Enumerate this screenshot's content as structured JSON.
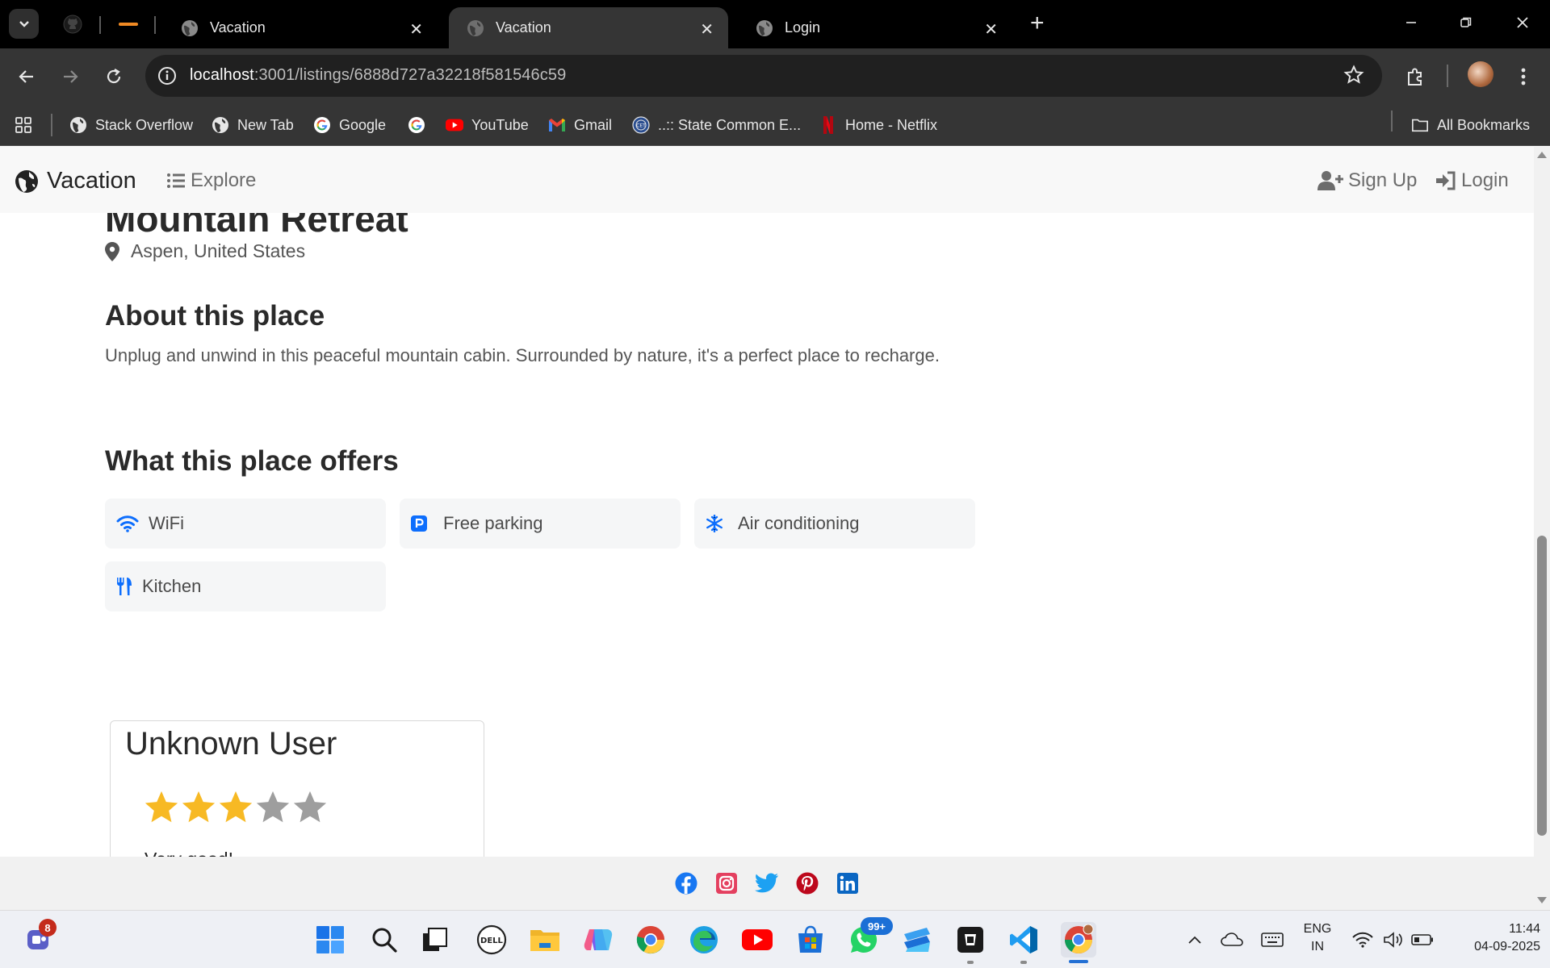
{
  "browser": {
    "tabs": [
      {
        "title": "Vacation",
        "active": false
      },
      {
        "title": "Vacation",
        "active": true
      },
      {
        "title": "Login",
        "active": false
      }
    ],
    "url_host": "localhost",
    "url_path": ":3001/listings/6888d727a32218f581546c59",
    "bookmarks": [
      {
        "label": "Stack Overflow",
        "icon": "globe-icon"
      },
      {
        "label": "New Tab",
        "icon": "globe-icon"
      },
      {
        "label": "Google",
        "icon": "google-icon"
      },
      {
        "label": "YouTube",
        "icon": "youtube-icon"
      },
      {
        "label": "Gmail",
        "icon": "gmail-icon"
      },
      {
        "label": "..:: State Common E...",
        "icon": "cet-icon"
      },
      {
        "label": "Home - Netflix",
        "icon": "netflix-icon"
      }
    ],
    "all_bookmarks": "All Bookmarks"
  },
  "navbar": {
    "brand": "Vacation",
    "explore": "Explore",
    "signup": "Sign Up",
    "login": "Login"
  },
  "listing": {
    "title": "Mountain Retreat",
    "location": "Aspen, United States",
    "about_heading": "About this place",
    "description": "Unplug and unwind in this peaceful mountain cabin. Surrounded by nature, it's a perfect place to recharge.",
    "offers_heading": "What this place offers",
    "amenities": [
      {
        "label": "WiFi",
        "icon": "wifi-icon"
      },
      {
        "label": "Free parking",
        "icon": "parking-icon"
      },
      {
        "label": "Air conditioning",
        "icon": "snowflake-icon"
      },
      {
        "label": "Kitchen",
        "icon": "utensils-icon"
      }
    ]
  },
  "review": {
    "author": "Unknown User",
    "rating": 3,
    "rating_max": 5,
    "comment": "Very good!"
  },
  "footer": {
    "social": [
      "facebook-icon",
      "instagram-icon",
      "twitter-icon",
      "pinterest-icon",
      "linkedin-icon"
    ]
  },
  "taskbar": {
    "teams_badge": "8",
    "whatsapp_badge": "99+",
    "language_line1": "ENG",
    "language_line2": "IN",
    "time": "11:44",
    "date": "04-09-2025"
  },
  "colors": {
    "accent_blue": "#0d6efd",
    "star_filled": "#f7b924",
    "star_empty": "#9e9e9e"
  }
}
